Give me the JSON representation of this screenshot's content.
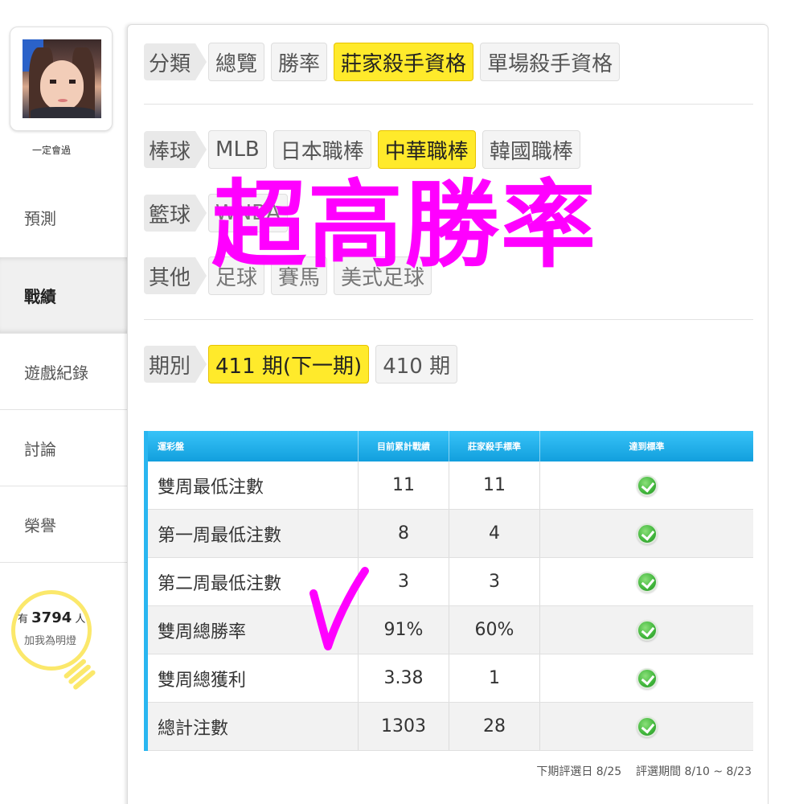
{
  "sidebar": {
    "username": "一定會過",
    "nav": [
      {
        "label": "預測"
      },
      {
        "label": "戰績"
      },
      {
        "label": "遊戲紀錄"
      },
      {
        "label": "討論"
      },
      {
        "label": "榮譽"
      }
    ],
    "active_nav": "戰績",
    "fans": {
      "prefix": "有",
      "count": "3794",
      "suffix": "人",
      "cta": "加我為明燈"
    }
  },
  "filters": {
    "category": {
      "label": "分類",
      "options": [
        "總覽",
        "勝率",
        "莊家殺手資格",
        "單場殺手資格"
      ],
      "selected": "莊家殺手資格"
    },
    "baseball": {
      "label": "棒球",
      "options": [
        "MLB",
        "日本職棒",
        "中華職棒",
        "韓國職棒"
      ],
      "selected": "中華職棒"
    },
    "basketball": {
      "label": "籃球",
      "options": [
        "WNBA"
      ]
    },
    "other": {
      "label": "其他",
      "options": [
        "足球",
        "賽馬",
        "美式足球"
      ]
    },
    "period": {
      "label": "期別",
      "options": [
        "411 期(下一期)",
        "410 期"
      ],
      "selected": "411 期(下一期)"
    }
  },
  "overlay": {
    "text": "超高勝率"
  },
  "table": {
    "headers": [
      "運彩盤",
      "目前累計戰績",
      "莊家殺手標準",
      "達到標準"
    ],
    "rows": [
      {
        "name": "雙周最低注數",
        "current": "11",
        "standard": "11",
        "met": true
      },
      {
        "name": "第一周最低注數",
        "current": "8",
        "standard": "4",
        "met": true
      },
      {
        "name": "第二周最低注數",
        "current": "3",
        "standard": "3",
        "met": true
      },
      {
        "name": "雙周總勝率",
        "current": "91%",
        "standard": "60%",
        "met": true
      },
      {
        "name": "雙周總獲利",
        "current": "3.38",
        "standard": "1",
        "met": true
      },
      {
        "name": "總計注數",
        "current": "1303",
        "standard": "28",
        "met": true
      }
    ]
  },
  "footnote": {
    "next_date": "下期評選日 8/25",
    "period": "評選期間 8/10 ~ 8/23"
  },
  "colors": {
    "accent_yellow": "#ffea2b",
    "table_header_blue": "#129fdd",
    "overlay_magenta": "#ff00ff",
    "check_green": "#3fb53a"
  }
}
